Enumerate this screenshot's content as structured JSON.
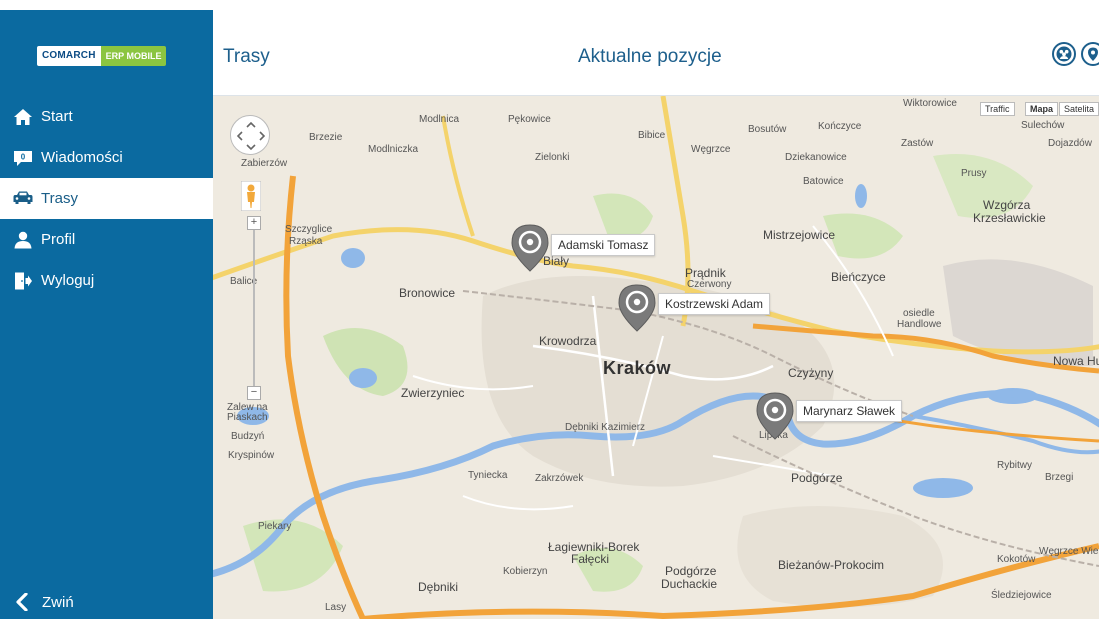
{
  "sidebar": {
    "logo_left": "COMARCH",
    "logo_right": "ERP MOBILE",
    "items": [
      {
        "label": "Start",
        "icon": "home-icon"
      },
      {
        "label": "Wiadomości",
        "icon": "message-icon"
      },
      {
        "label": "Trasy",
        "icon": "car-icon",
        "active": true
      },
      {
        "label": "Profil",
        "icon": "user-icon"
      },
      {
        "label": "Wyloguj",
        "icon": "logout-icon"
      }
    ],
    "collapse_label": "Zwiń"
  },
  "header": {
    "left_title": "Trasy",
    "center_title": "Aktualne pozycje"
  },
  "map": {
    "type_buttons": {
      "traffic": "Traffic",
      "map": "Mapa",
      "satellite": "Satelita"
    },
    "zoom_in": "+",
    "zoom_out": "−",
    "markers": [
      {
        "name": "Adamski Tomasz"
      },
      {
        "name": "Kostrzewski Adam"
      },
      {
        "name": "Marynarz Sławek"
      }
    ],
    "places": {
      "krakow": "Kraków",
      "bronowice": "Bronowice",
      "krowodrza": "Krowodrza",
      "zwierzyniec": "Zwierzyniec",
      "bialy": "Biały",
      "pradnik": "Prądnik",
      "czerwony": "Czerwony",
      "mistrzejowice": "Mistrzejowice",
      "bienczyce": "Bieńczyce",
      "czyzyny": "Czyżyny",
      "podgorze": "Podgórze",
      "lagiewniki": "Łagiewniki-Borek",
      "falecki": "Fałęcki",
      "podgorze_duchackie_1": "Podgórze",
      "podgorze_duchackie_2": "Duchackie",
      "biezanow": "Bieżanów-Prokocim",
      "debniki": "Dębniki",
      "wzgorza_1": "Wzgórza",
      "wzgorza_2": "Krzesławickie",
      "nowa_huta": "Nowa Hu",
      "modlniczka": "Modlniczka",
      "zielonki": "Zielonki",
      "wegrzce": "Węgrzce",
      "batowice": "Batowice",
      "zabierzow": "Zabierzów",
      "rzaska": "Rząska",
      "balice": "Balice",
      "brzezie": "Brzezie",
      "modlnica": "Modlnica",
      "pekowice": "Pękowice",
      "bibice": "Bibice",
      "bosutow": "Bosutów",
      "konczyce": "Kończyce",
      "zastow": "Zastów",
      "wiktorowice": "Wiktorowice",
      "dojazdow": "Dojazdów",
      "sulechow": "Sulechów",
      "dziekanowice": "Dziekanowice",
      "prusy": "Prusy",
      "kryspinow": "Kryspinów",
      "budzyn": "Budzyń",
      "piekary": "Piekary",
      "kobierzyn": "Kobierzyn",
      "zakrzowek": "Zakrzówek",
      "debniki_kazimierz": "Dębniki Kazimierz",
      "lipska": "Lipska",
      "osiedle": "osiedle",
      "handlowe": "Handlowe",
      "rybitwy": "Rybitwy",
      "brzegi": "Brzegi",
      "kokotow": "Kokotów",
      "wegrzce_wielkie": "Węgrzce Wielkie",
      "sledziejowice": "Śledziejowice",
      "lasy": "Lasy",
      "tyniecka": "Tyniecka",
      "szczyglice": "Szczyglice",
      "zalew_1": "Zalew na",
      "zalew_2": "Piaskach"
    }
  }
}
